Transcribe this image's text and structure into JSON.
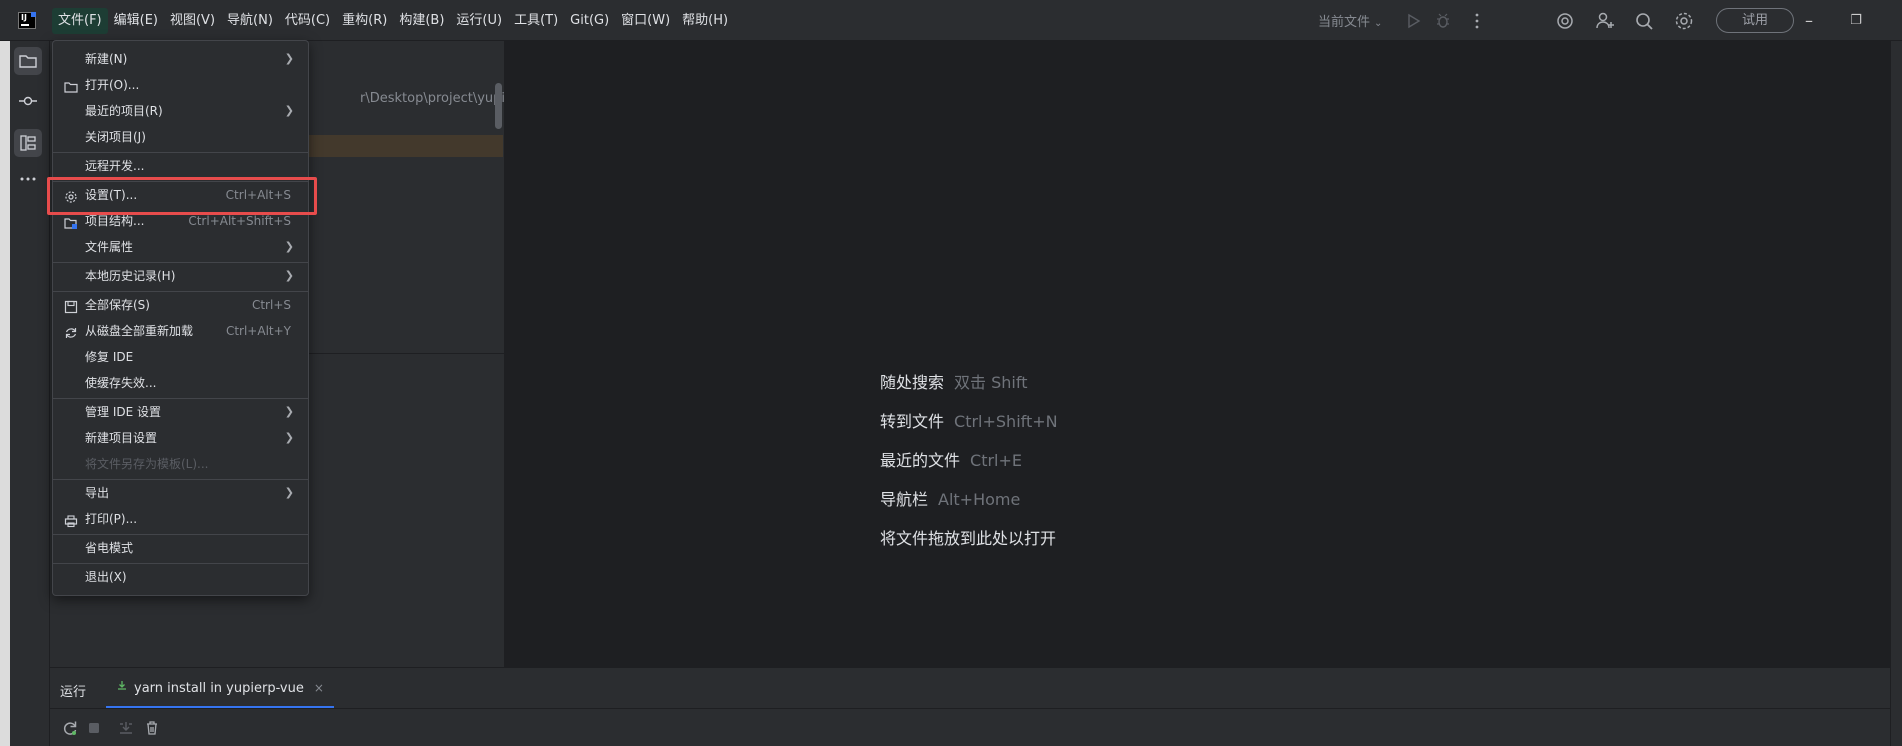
{
  "titlebar": {
    "logo": "ide-logo",
    "menu": [
      {
        "label": "文件(F)",
        "active": true
      },
      {
        "label": "编辑(E)"
      },
      {
        "label": "视图(V)"
      },
      {
        "label": "导航(N)"
      },
      {
        "label": "代码(C)"
      },
      {
        "label": "重构(R)"
      },
      {
        "label": "构建(B)"
      },
      {
        "label": "运行(U)"
      },
      {
        "label": "工具(T)"
      },
      {
        "label": "Git(G)"
      },
      {
        "label": "窗口(W)"
      },
      {
        "label": "帮助(H)"
      }
    ],
    "current_file_label": "当前文件",
    "trial_label": "试用",
    "icons": [
      "run-icon",
      "debug-icon",
      "more-vertical-icon",
      "ai-assistant-icon",
      "add-user-icon",
      "search-icon",
      "gear-icon"
    ]
  },
  "left_stripe": {
    "icons": [
      "folder-icon",
      "commit-icon",
      "structure-icon",
      "more-horizontal-icon"
    ]
  },
  "project_panel": {
    "path_fragment": "r\\Desktop\\project\\yupierp-vue"
  },
  "file_menu": {
    "items": [
      {
        "label": "新建(N)",
        "submenu": true
      },
      {
        "label": "打开(O)...",
        "icon": "folder-open-icon"
      },
      {
        "label": "最近的项目(R)",
        "submenu": true
      },
      {
        "label": "关闭项目(J)"
      },
      {
        "separator": true
      },
      {
        "label": "远程开发..."
      },
      {
        "separator": true
      },
      {
        "label": "设置(T)...",
        "icon": "gear-icon",
        "shortcut": "Ctrl+Alt+S",
        "highlighted": true
      },
      {
        "label": "项目结构...",
        "icon": "project-structure-icon",
        "shortcut": "Ctrl+Alt+Shift+S"
      },
      {
        "label": "文件属性",
        "submenu": true
      },
      {
        "separator": true
      },
      {
        "label": "本地历史记录(H)",
        "submenu": true
      },
      {
        "separator": true
      },
      {
        "label": "全部保存(S)",
        "icon": "save-icon",
        "shortcut": "Ctrl+S"
      },
      {
        "label": "从磁盘全部重新加载",
        "icon": "reload-icon",
        "shortcut": "Ctrl+Alt+Y"
      },
      {
        "label": "修复 IDE"
      },
      {
        "label": "使缓存失效..."
      },
      {
        "separator": true
      },
      {
        "label": "管理 IDE 设置",
        "submenu": true
      },
      {
        "label": "新建项目设置",
        "submenu": true
      },
      {
        "label": "将文件另存为模板(L)...",
        "disabled": true
      },
      {
        "separator": true
      },
      {
        "label": "导出",
        "submenu": true
      },
      {
        "label": "打印(P)...",
        "icon": "print-icon"
      },
      {
        "separator": true
      },
      {
        "label": "省电模式"
      },
      {
        "separator": true
      },
      {
        "label": "退出(X)"
      }
    ]
  },
  "editor_hints": [
    {
      "label": "随处搜索",
      "key": "双击 Shift"
    },
    {
      "label": "转到文件",
      "key": "Ctrl+Shift+N"
    },
    {
      "label": "最近的文件",
      "key": "Ctrl+E"
    },
    {
      "label": "导航栏",
      "key": "Alt+Home"
    },
    {
      "label": "将文件拖放到此处以打开",
      "key": ""
    }
  ],
  "run_panel": {
    "title": "运行",
    "tab_label": "yarn install in yupierp-vue",
    "tab_close": "×",
    "tools": [
      "rerun-icon",
      "stop-icon",
      "scroll-to-end-icon",
      "trash-icon"
    ]
  },
  "colors": {
    "background": "#2b2d30",
    "editor": "#1e1f22",
    "accent": "#3574f0",
    "highlight_box": "#e74c4c"
  }
}
